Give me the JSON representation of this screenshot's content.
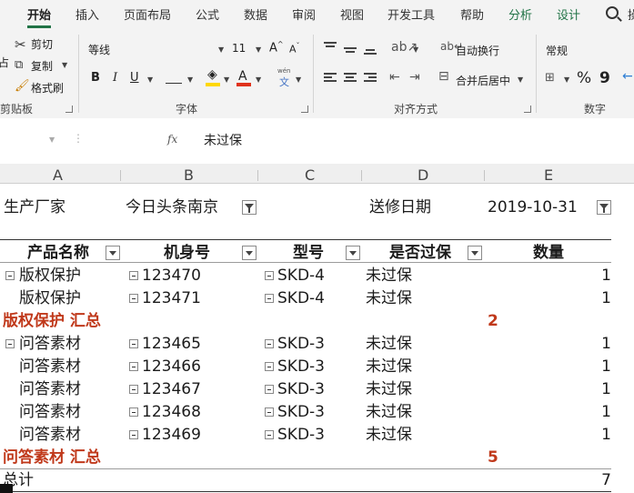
{
  "ribbon": {
    "tabs": [
      "开始",
      "插入",
      "页面布局",
      "公式",
      "数据",
      "审阅",
      "视图",
      "开发工具",
      "帮助",
      "分析",
      "设计"
    ],
    "tab_partial": "操",
    "clipboard": {
      "cut": "剪切",
      "copy": "复制",
      "format_painter": "格式刷",
      "group": "剪贴板"
    },
    "font": {
      "name": "等线",
      "size": "11",
      "bold": "B",
      "italic": "I",
      "underline": "U",
      "wen": "文",
      "group": "字体"
    },
    "alignment": {
      "wrap": "自动换行",
      "merge": "合并后居中",
      "group": "对齐方式"
    },
    "number": {
      "format": "常规",
      "percent": "%",
      "comma": "9",
      "group": "数字"
    },
    "colors": {
      "accent": "#217346",
      "fill": "#ffd800",
      "font_color": "#e0321c"
    }
  },
  "formula_bar": {
    "fx": "fx",
    "value": "未过保"
  },
  "columns": [
    "A",
    "B",
    "C",
    "D",
    "E"
  ],
  "sheet": {
    "filter1_label": "生产厂家",
    "filter1_value": "今日头条南京",
    "filter2_label": "送修日期",
    "filter2_value": "2019-10-31",
    "headers": [
      "产品名称",
      "机身号",
      "型号",
      "是否过保",
      "数量"
    ],
    "rows": [
      [
        "版权保护",
        "123470",
        "SKD-4",
        "未过保",
        "1"
      ],
      [
        "版权保护",
        "123471",
        "SKD-4",
        "未过保",
        "1"
      ],
      [
        "版权保护 汇总",
        "",
        "",
        "2",
        ""
      ],
      [
        "问答素材",
        "123465",
        "SKD-3",
        "未过保",
        "1"
      ],
      [
        "问答素材",
        "123466",
        "SKD-3",
        "未过保",
        "1"
      ],
      [
        "问答素材",
        "123467",
        "SKD-3",
        "未过保",
        "1"
      ],
      [
        "问答素材",
        "123468",
        "SKD-3",
        "未过保",
        "1"
      ],
      [
        "问答素材",
        "123469",
        "SKD-3",
        "未过保",
        "1"
      ],
      [
        "问答素材 汇总",
        "",
        "",
        "5",
        ""
      ],
      [
        "总计",
        "",
        "",
        "",
        "7"
      ]
    ]
  }
}
